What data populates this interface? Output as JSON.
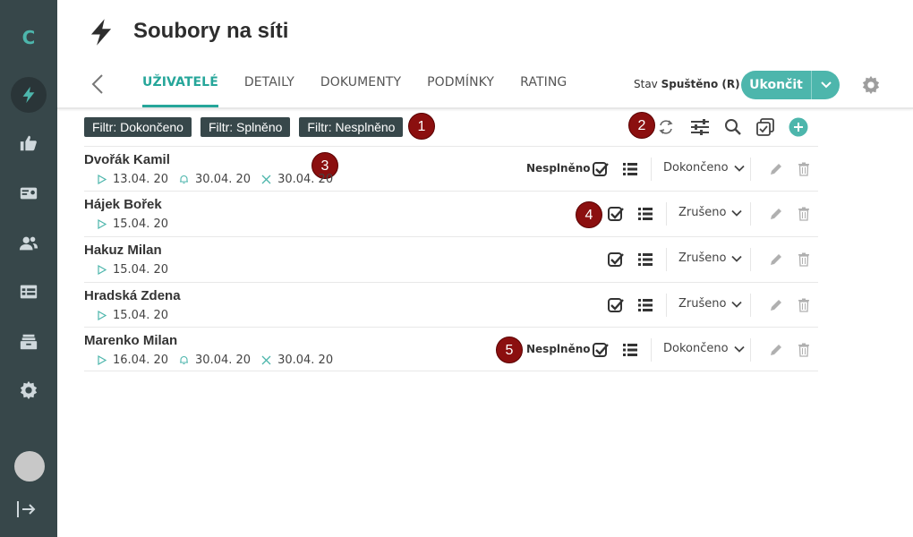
{
  "app": {
    "logo_letter": "C"
  },
  "header": {
    "title": "Soubory na síti",
    "tabs": [
      {
        "label": "UŽIVATELÉ",
        "active": true
      },
      {
        "label": "DETAILY",
        "active": false
      },
      {
        "label": "DOKUMENTY",
        "active": false
      },
      {
        "label": "PODMÍNKY",
        "active": false
      },
      {
        "label": "RATING",
        "active": false
      }
    ],
    "status_label": "Stav",
    "status_value": "Spuštěno (R)",
    "end_button": "Ukončit"
  },
  "filters": [
    "Filtr: Dokončeno",
    "Filtr: Splněno",
    "Filtr: Nesplněno"
  ],
  "badges": [
    "1",
    "2",
    "3",
    "4",
    "5"
  ],
  "rows": [
    {
      "name": "Dvořák Kamil",
      "start": "13.04. 20",
      "remind": "30.04. 20",
      "end": "30.04. 20",
      "state": "Nesplněno",
      "dropdown": "Dokončeno"
    },
    {
      "name": "Hájek Bořek",
      "start": "15.04. 20",
      "remind": "",
      "end": "",
      "state": "",
      "dropdown": "Zrušeno"
    },
    {
      "name": "Hakuz Milan",
      "start": "15.04. 20",
      "remind": "",
      "end": "",
      "state": "",
      "dropdown": "Zrušeno"
    },
    {
      "name": "Hradská Zdena",
      "start": "15.04. 20",
      "remind": "",
      "end": "",
      "state": "",
      "dropdown": "Zrušeno"
    },
    {
      "name": "Marenko Milan",
      "start": "16.04. 20",
      "remind": "30.04. 20",
      "end": "30.04. 20",
      "state": "Nesplněno",
      "dropdown": "Dokončeno"
    }
  ],
  "colors": {
    "accent": "#4db6ac",
    "sidebar": "#37474a",
    "badge": "#8b0f0f"
  }
}
